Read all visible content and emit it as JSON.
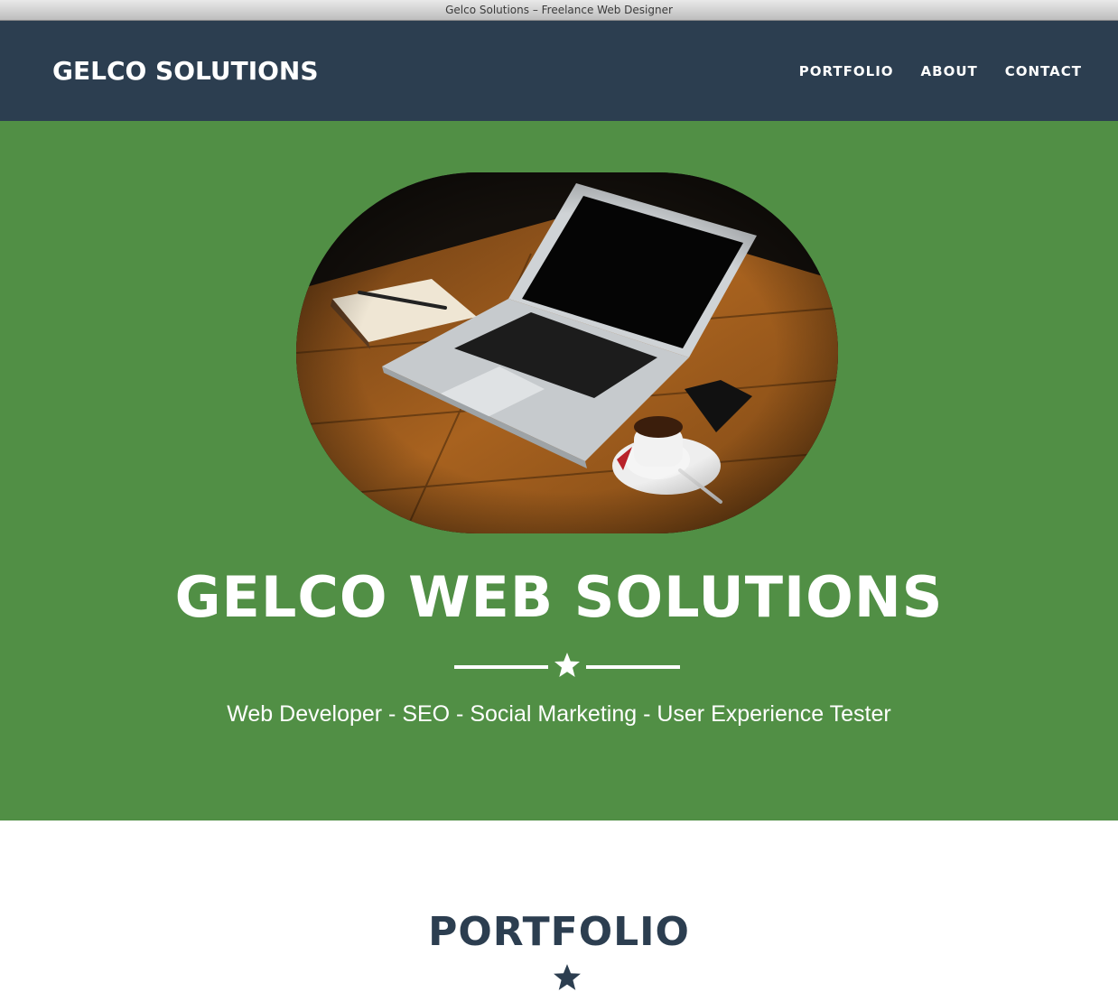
{
  "window": {
    "title": "Gelco Solutions – Freelance Web Designer"
  },
  "navbar": {
    "brand": "GELCO SOLUTIONS",
    "links": [
      {
        "label": "PORTFOLIO"
      },
      {
        "label": "ABOUT"
      },
      {
        "label": "CONTACT"
      }
    ]
  },
  "hero": {
    "image_subject": "laptop-desk-photo",
    "title": "GELCO WEB SOLUTIONS",
    "divider_icon": "star-icon",
    "subtitle": "Web Developer - SEO - Social Marketing - User Experience Tester"
  },
  "portfolio": {
    "title": "PORTFOLIO",
    "divider_icon": "star-icon"
  },
  "colors": {
    "navbar": "#2c3e50",
    "hero": "#518f45",
    "text_light": "#ffffff",
    "section_title": "#2c3e50"
  }
}
